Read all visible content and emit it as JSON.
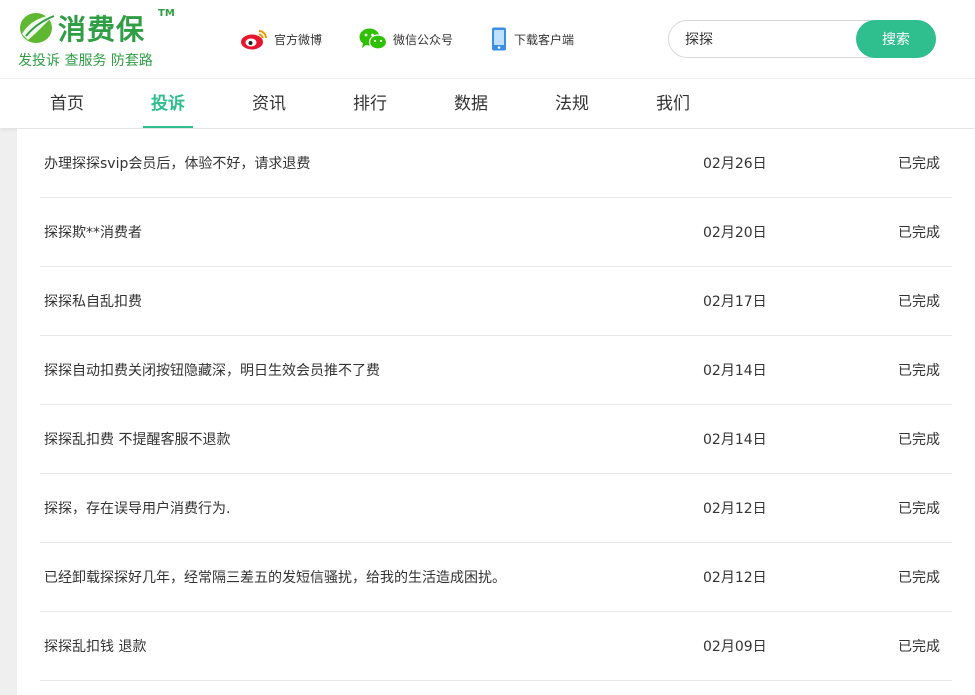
{
  "logo": {
    "title": "消费保",
    "tm": "TM",
    "slogan": "发投诉 查服务 防套路"
  },
  "top_links": [
    {
      "label": "官方微博",
      "icon": "weibo-icon"
    },
    {
      "label": "微信公众号",
      "icon": "wechat-icon"
    },
    {
      "label": "下载客户端",
      "icon": "phone-icon"
    }
  ],
  "search": {
    "value": "探探",
    "button_label": "搜索"
  },
  "nav": {
    "items": [
      "首页",
      "投诉",
      "资讯",
      "排行",
      "数据",
      "法规",
      "我们"
    ],
    "active_index": 1
  },
  "complaints": [
    {
      "title": "办理探探svip会员后，体验不好，请求退费",
      "date": "02月26日",
      "status": "已完成"
    },
    {
      "title": "探探欺**消费者",
      "date": "02月20日",
      "status": "已完成"
    },
    {
      "title": "探探私自乱扣费",
      "date": "02月17日",
      "status": "已完成"
    },
    {
      "title": "探探自动扣费关闭按钮隐藏深，明日生效会员推不了费",
      "date": "02月14日",
      "status": "已完成"
    },
    {
      "title": "探探乱扣费 不提醒客服不退款",
      "date": "02月14日",
      "status": "已完成"
    },
    {
      "title": "探探，存在误导用户消费行为.",
      "date": "02月12日",
      "status": "已完成"
    },
    {
      "title": "已经卸载探探好几年，经常隔三差五的发短信骚扰，给我的生活造成困扰。",
      "date": "02月12日",
      "status": "已完成"
    },
    {
      "title": "探探乱扣钱 退款",
      "date": "02月09日",
      "status": "已完成"
    }
  ],
  "colors": {
    "brand_green": "#2f9e45",
    "accent": "#2fbf8e",
    "weibo_red": "#e6162d",
    "wechat_green": "#2dc100",
    "phone_blue": "#3a8ee6"
  }
}
